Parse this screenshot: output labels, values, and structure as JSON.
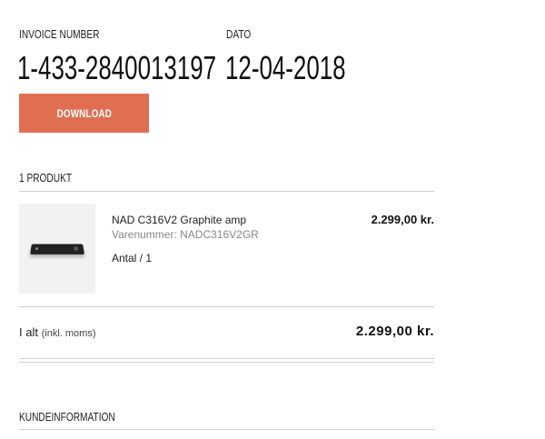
{
  "invoice": {
    "number_label": "INVOICE NUMBER",
    "number_value": "1-433-2840013197",
    "date_label": "DATO",
    "date_value": "12-04-2018",
    "download_label": "DOWNLOAD"
  },
  "products": {
    "section_title": "1 PRODUKT",
    "items": [
      {
        "name": "NAD C316V2 Graphite amp",
        "sku": "Varenummer: NADC316V2GR",
        "quantity": "Antal / 1",
        "price": "2.299,00 kr.",
        "image_icon": "amplifier-product-image"
      }
    ]
  },
  "total": {
    "label": "I alt",
    "sublabel": "(inkl. moms)",
    "value": "2.299,00 kr."
  },
  "customer": {
    "section_title": "KUNDEINFORMATION"
  },
  "colors": {
    "accent": "#e06f52",
    "divider": "#cfcfcf"
  }
}
